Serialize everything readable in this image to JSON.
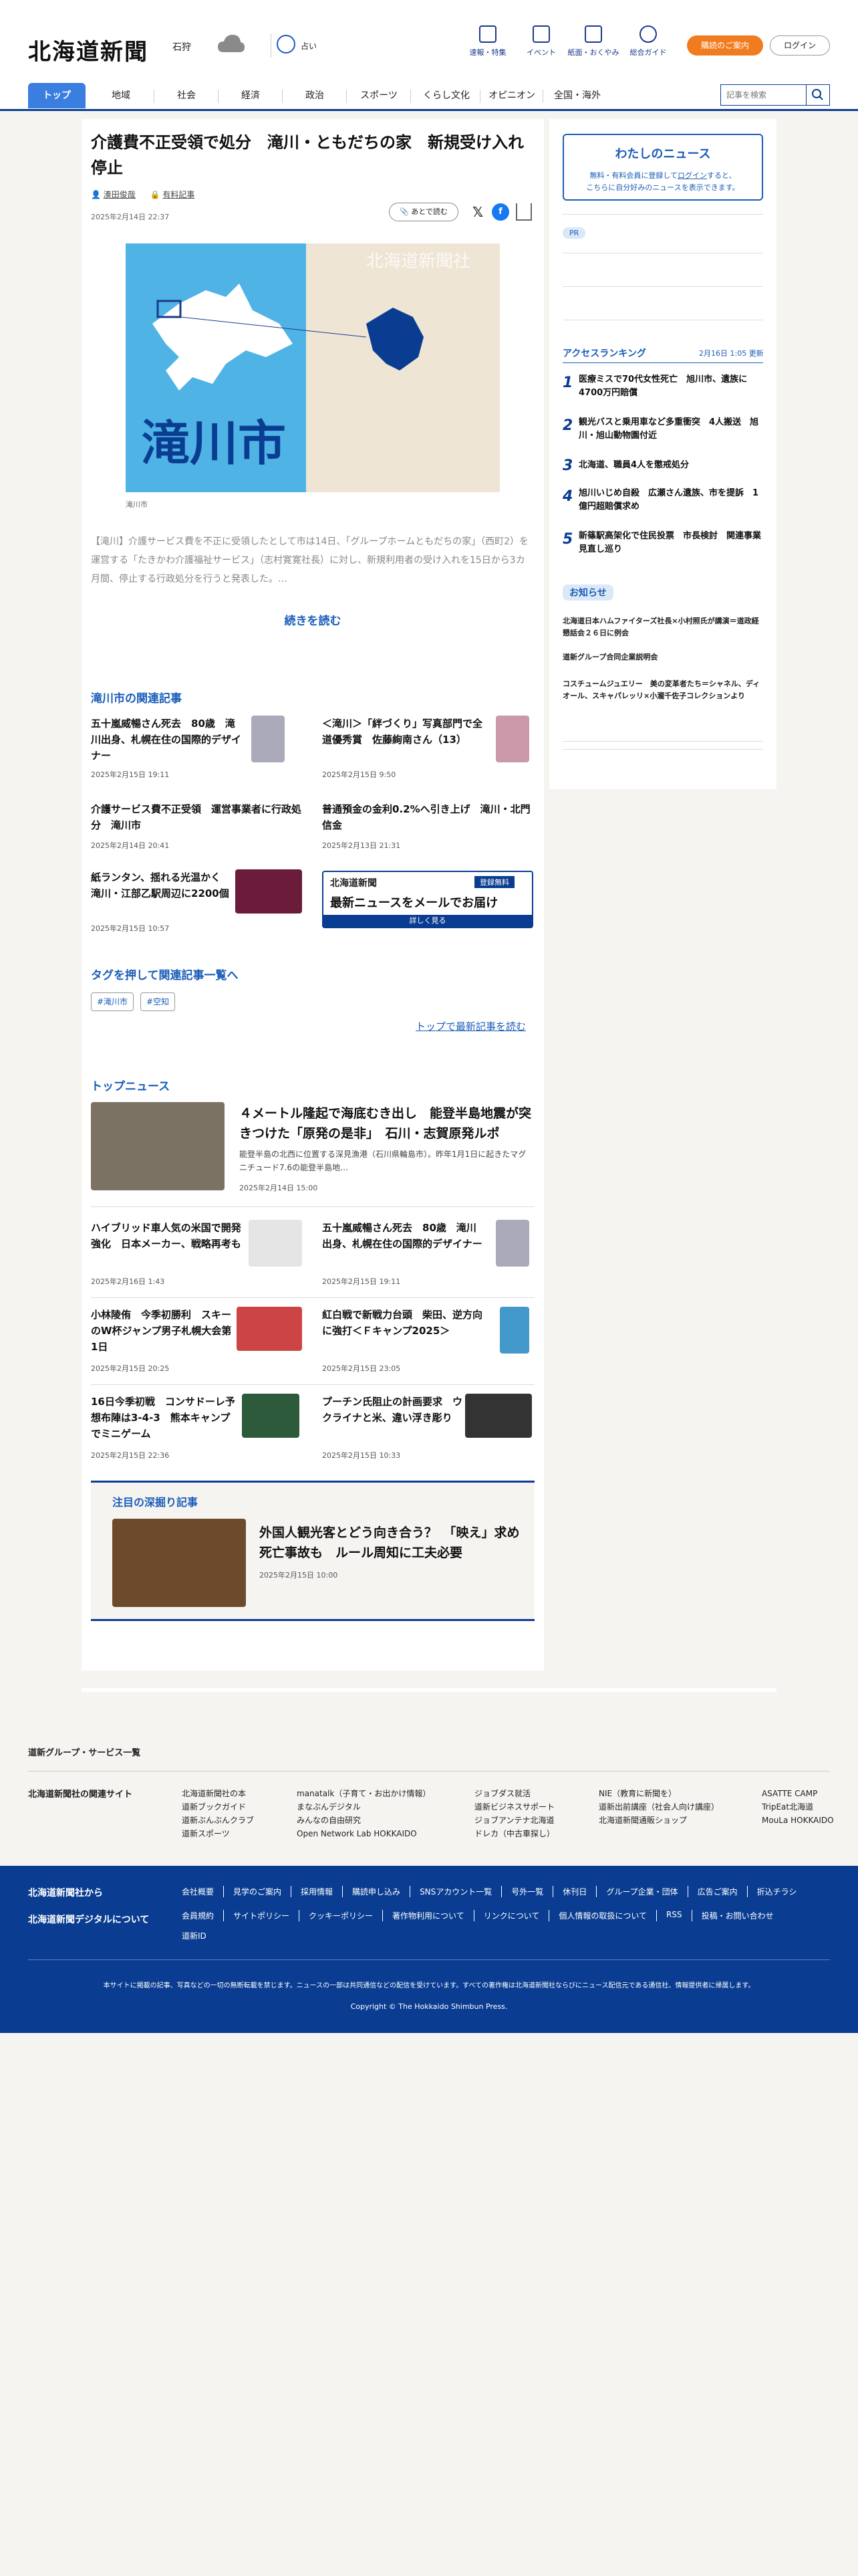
{
  "header": {
    "logo": "北海道新聞",
    "region": "石狩",
    "weather_label": "占い",
    "nav": [
      {
        "label": "速報・特集"
      },
      {
        "label": "イベント"
      },
      {
        "label": "紙面・おくやみ"
      },
      {
        "label": "総合ガイド"
      }
    ],
    "subscribe": "購読のご案内",
    "login": "ログイン"
  },
  "gnav": {
    "tabs": [
      "トップ",
      "地域",
      "社会",
      "経済",
      "政治",
      "スポーツ",
      "くらし文化",
      "オピニオン",
      "全国・海外"
    ],
    "search_placeholder": "記事を検索"
  },
  "article": {
    "title": "介護費不正受領で処分　滝川・ともだちの家　新規受け入れ停止",
    "author": "湊田俊哉",
    "paid_label": "有料記事",
    "date": "2025年2月14日 22:37",
    "later": "あとで読む",
    "image_caption": "滝川市",
    "image_city": "滝川市",
    "image_watermark": "北海道新聞社",
    "body": "【滝川】介護サービス費を不正に受領したとして市は14日、「グループホームともだちの家」（西町2）を運営する「たきかわ介護福祉サービス」（志村寛寛社長）に対し、新規利用者の受け入れを15日から3カ月間、停止する行政処分を行うと発表した。…",
    "read_more": "続きを読む"
  },
  "related": {
    "heading": "滝川市の関連記事",
    "items": [
      {
        "title": "五十嵐威暢さん死去　80歳　滝川出身、札幌在住の国際的デザイナー",
        "date": "2025年2月15日 19:11"
      },
      {
        "title": "＜滝川＞「絆づくり」写真部門で全道優秀賞　佐藤絢南さん（13）",
        "date": "2025年2月15日 9:50"
      },
      {
        "title": "介護サービス費不正受領　運営事業者に行政処分　滝川市",
        "date": "2025年2月14日 20:41"
      },
      {
        "title": "普通預金の金利0.2%へ引き上げ　滝川・北門信金",
        "date": "2025年2月13日 21:31"
      },
      {
        "title": "紙ランタン、揺れる光温かく　滝川・江部乙駅周辺に2200個",
        "date": "2025年2月15日 10:57"
      }
    ],
    "banner": {
      "logo": "北海道新聞",
      "tag": "登録無料",
      "main": "最新ニュースをメールでお届け",
      "sub": "詳しく見る"
    }
  },
  "tags": {
    "heading": "タグを押して関連記事一覧へ",
    "items": [
      "#滝川市",
      "#空知"
    ],
    "top_link": "トップで最新記事を読む"
  },
  "top_news": {
    "heading": "トップニュース",
    "lead": {
      "title": "４メートル隆起で海底むき出し　能登半島地震が突きつけた「原発の是非」　石川・志賀原発ルポ",
      "desc": "能登半島の北西に位置する深見漁港（石川県輪島市）。昨年1月1日に起きたマグニチュード7.6の能登半島地…",
      "date": "2025年2月14日 15:00"
    },
    "items": [
      {
        "title": "ハイブリッド車人気の米国で開発強化　日本メーカー、戦略再考も",
        "date": "2025年2月16日 1:43"
      },
      {
        "title": "五十嵐威暢さん死去　80歳　滝川出身、札幌在住の国際的デザイナー",
        "date": "2025年2月15日 19:11"
      },
      {
        "title": "小林陵侑　今季初勝利　スキーのW杯ジャンプ男子札幌大会第1日",
        "date": "2025年2月15日 20:25"
      },
      {
        "title": "紅白戦で新戦力台頭　柴田、逆方向に強打＜Ｆキャンプ2025＞",
        "date": "2025年2月15日 23:05"
      },
      {
        "title": "16日今季初戦　コンサドーレ予想布陣は3-4-3　熊本キャンプでミニゲーム",
        "date": "2025年2月15日 22:36"
      },
      {
        "title": "プーチン氏阻止の計画要求　ウクライナと米、違い浮き彫り",
        "date": "2025年2月15日 10:33"
      }
    ]
  },
  "feature": {
    "heading": "注目の深掘り記事",
    "title": "外国人観光客とどう向き合う？　「映え」求め死亡事故も　ルール周知に工夫必要",
    "date": "2025年2月15日 10:00"
  },
  "aside": {
    "my_news_title": "わたしのニュース",
    "my_news_text_1": "無料・有料会員に登録して",
    "my_news_login": "ログイン",
    "my_news_text_2": "すると、",
    "my_news_text_3": "こちらに自分好みのニュースを表示できます。",
    "pr": "PR",
    "ranking_heading": "アクセスランキング",
    "ranking_updated": "2月16日 1:05 更新",
    "ranking": [
      {
        "n": "1",
        "title": "医療ミスで70代女性死亡　旭川市、遺族に4700万円賠償"
      },
      {
        "n": "2",
        "title": "観光バスと乗用車など多重衝突　4人搬送　旭川・旭山動物園付近"
      },
      {
        "n": "3",
        "title": "北海道、職員4人を懲戒処分"
      },
      {
        "n": "4",
        "title": "旭川いじめ自殺　広瀬さん遺族、市を提訴　1億円超賠償求め"
      },
      {
        "n": "5",
        "title": "新篠駅高架化で住民投票　市長検討　関連事業見直し巡り"
      }
    ],
    "notice_heading": "お知らせ",
    "notices": [
      "北海道日本ハムファイターズ社長×小村照氏が講演＝道政経懇話会２６日に例会",
      "道新グループ合同企業説明会",
      "コスチュームジュエリー　美の変革者たち＝シャネル、ディオール、スキャパレッリ×小瀧千佐子コレクションより"
    ]
  },
  "footer": {
    "group": "道新グループ・サービス一覧",
    "related_label": "北海道新聞社の関連サイト",
    "cols": [
      [
        "北海道新聞社の本",
        "道新ブックガイド",
        "道新ぶんぶんクラブ",
        "道新スポーツ"
      ],
      [
        "manatalk（子育て・お出かけ情報）",
        "まなぶんデジタル",
        "みんなの自由研究",
        "Open Network Lab HOKKAIDO"
      ],
      [
        "ジョブダス就活",
        "道新ビジネスサポート",
        "ジョブアンテナ北海道",
        "ドレカ（中古車探し）"
      ],
      [
        "NIE（教育に新聞を）",
        "道新出前講座（社会人向け講座）",
        "北海道新聞通販ショップ"
      ],
      [
        "ASATTE CAMP",
        "TripEat北海道",
        "MouLa HOKKAIDO"
      ]
    ],
    "blue_l1": "北海道新聞社から",
    "blue_l2": "北海道新聞デジタルについて",
    "row1": [
      "会社概要",
      "見学のご案内",
      "採用情報",
      "購読申し込み",
      "SNSアカウント一覧",
      "号外一覧",
      "休刊日",
      "グループ企業・団体",
      "広告ご案内",
      "折込チラシ"
    ],
    "row2": [
      "会員規約",
      "サイトポリシー",
      "クッキーポリシー",
      "著作物利用について",
      "リンクについて",
      "個人情報の取扱について",
      "RSS",
      "投稿・お問い合わせ"
    ],
    "row3": [
      "道新ID"
    ],
    "notice": "本サイトに掲載の記事、写真などの一切の無断転載を禁じます。ニュースの一部は共同通信などの配信を受けています。すべての著作権は北海道新聞社ならびにニュース配信元である通信社、情報提供者に帰属します。",
    "copyright": "Copyright © The Hokkaido Shimbun Press."
  }
}
